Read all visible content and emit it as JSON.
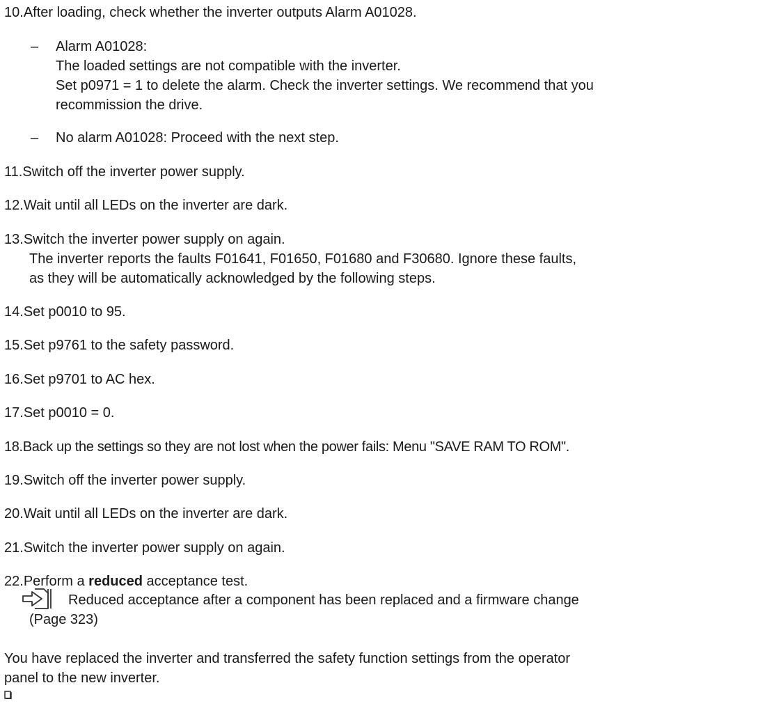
{
  "steps": {
    "s10": {
      "num": "10.",
      "text": "After loading, check whether the inverter outputs Alarm A01028."
    },
    "s10_sub1": {
      "dash": "–",
      "title": "Alarm A01028:",
      "line1": "The loaded settings are not compatible with the inverter.",
      "line2": "Set p0971 = 1 to delete the alarm. Check the inverter settings. We recommend that you",
      "line3": "recommission the drive."
    },
    "s10_sub2": {
      "dash": "–",
      "text": "No alarm A01028: Proceed with the next step."
    },
    "s11": {
      "num": "11.",
      "text": "Switch off the inverter power supply."
    },
    "s12": {
      "num": "12.",
      "text": "Wait until all LEDs on the inverter are dark."
    },
    "s13": {
      "num": "13.",
      "line1": "Switch the inverter power supply on again.",
      "line2": "The inverter reports the faults F01641, F01650, F01680 and F30680. Ignore these faults,",
      "line3": "as they will be automatically acknowledged by the following steps."
    },
    "s14": {
      "num": "14.",
      "text": "Set p0010 to 95."
    },
    "s15": {
      "num": "15.",
      "text": "Set p9761 to the safety password."
    },
    "s16": {
      "num": "16.",
      "text": "Set p9701 to AC hex."
    },
    "s17": {
      "num": "17.",
      "text": "Set p0010 = 0."
    },
    "s18": {
      "num": "18.",
      "text": "Back up the settings so they are not lost when the power fails: Menu \"SAVE RAM TO ROM\"."
    },
    "s19": {
      "num": "19.",
      "text": "Switch off the inverter power supply."
    },
    "s20": {
      "num": "20.",
      "text": "Wait until all LEDs on the inverter are dark."
    },
    "s21": {
      "num": "21.",
      "text": "Switch the inverter power supply on again."
    },
    "s22": {
      "num": "22.",
      "pre": "Perform a ",
      "bold": "reduced",
      "post": " acceptance test.",
      "link_line1": "Reduced acceptance after a component has been replaced and a firmware change",
      "link_line2": "(Page 323)"
    }
  },
  "summary": {
    "line1": "You have replaced the inverter and transferred the safety function settings from the operator",
    "line2": "panel to the new inverter."
  },
  "icons": {
    "link": "cross-reference-icon",
    "end": "end-of-procedure-icon"
  }
}
